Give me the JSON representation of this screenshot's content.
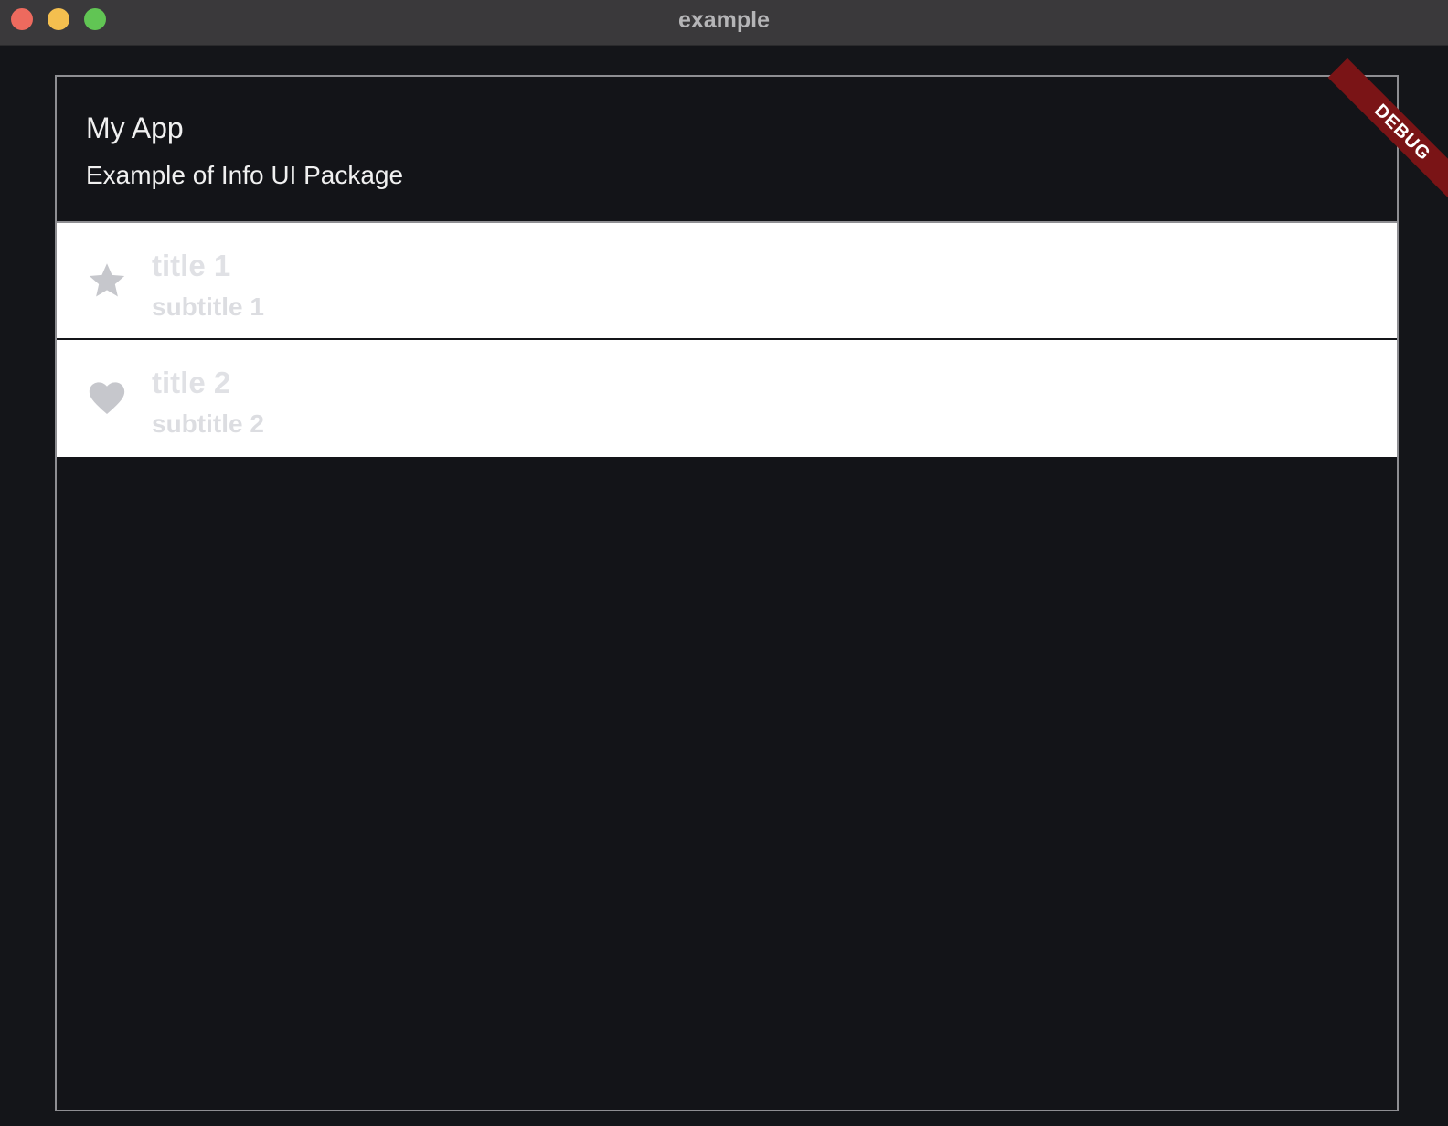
{
  "window": {
    "title": "example"
  },
  "app": {
    "title": "My App",
    "subtitle": "Example of Info UI Package"
  },
  "list": {
    "items": [
      {
        "icon": "star-icon",
        "title": "title 1",
        "subtitle": "subtitle 1"
      },
      {
        "icon": "heart-icon",
        "title": "title 2",
        "subtitle": "subtitle 2"
      }
    ]
  },
  "debug_banner": {
    "label": "DEBUG"
  },
  "colors": {
    "background": "#141519",
    "titlebar": "#3a393b",
    "list_item_bg": "#ffffff",
    "list_text": "#e0e1e5",
    "icon": "#c6c7cc",
    "debug_banner": "#7a1416"
  }
}
